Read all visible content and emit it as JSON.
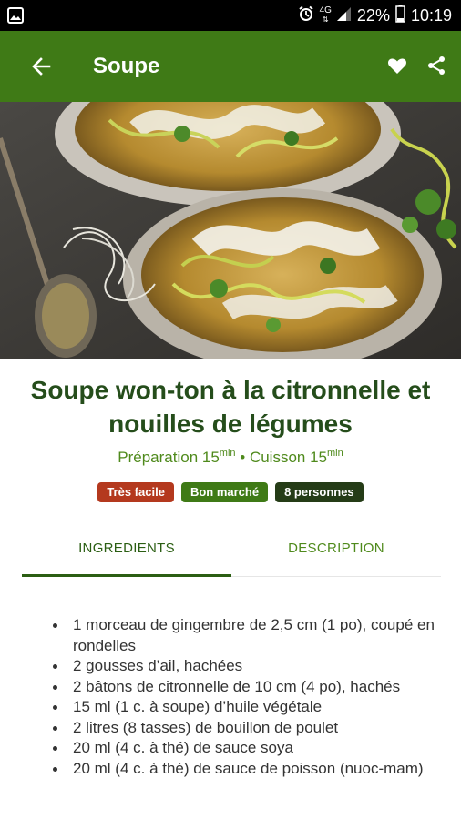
{
  "status_bar": {
    "alarm_icon": "alarm-icon",
    "network_type": "4G",
    "battery": "22%",
    "time": "10:19"
  },
  "app_bar": {
    "title": "Soupe",
    "background_color": "#3f7a16"
  },
  "recipe": {
    "title": "Soupe won-ton à la citronnelle et nouilles de légumes",
    "prep_label": "Préparation 15",
    "prep_unit": "min",
    "separator": " • ",
    "cook_label": "Cuisson 15",
    "cook_unit": "min",
    "badges": [
      {
        "label": "Très facile",
        "color": "#b4391e"
      },
      {
        "label": "Bon marché",
        "color": "#3f7a16"
      },
      {
        "label": "8 personnes",
        "color": "#253c17"
      }
    ]
  },
  "tabs": [
    {
      "label": "INGREDIENTS",
      "active": true
    },
    {
      "label": "DESCRIPTION",
      "active": false
    }
  ],
  "ingredients": [
    "1 morceau de gingembre de 2,5 cm (1 po), coupé en rondelles",
    "2 gousses d’ail, hachées",
    "2 bâtons de citronnelle de 10 cm (4 po), hachés",
    "15 ml (1 c. à soupe) d’huile végétale",
    "2 litres (8 tasses) de bouillon de poulet",
    "20 ml (4 c. à thé) de sauce soya",
    "20 ml (4 c. à thé) de sauce de poisson (nuoc-mam)"
  ]
}
